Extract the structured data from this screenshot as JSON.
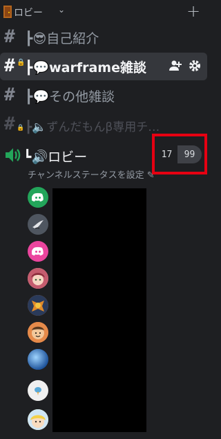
{
  "category": {
    "label": "ロビー",
    "emoji_icon": "door-icon",
    "add_icon": "plus-icon"
  },
  "channels": [
    {
      "name": "┣😎自己紹介",
      "state": "normal"
    },
    {
      "name": "┣💬warframe雑談",
      "state": "selected",
      "actions": [
        "add-member-icon",
        "gear-icon"
      ]
    },
    {
      "name": "┣💬その他雑談",
      "state": "normal"
    },
    {
      "name": "┣🔈ずんだもんβ専用チ…",
      "state": "muted"
    }
  ],
  "voice_channel": {
    "name": "┗🔊ロビー",
    "user_count": "17",
    "user_limit": "99",
    "status_text": "チャンネルステータスを設定 ✎"
  },
  "members": [
    {
      "avatar_icon": "discord-green-avatar",
      "color": "#23a55a"
    },
    {
      "avatar_icon": "bird-avatar",
      "color": "#4f5660"
    },
    {
      "avatar_icon": "discord-pink-avatar",
      "color": "#eb459e"
    },
    {
      "avatar_icon": "anime-girl-avatar",
      "color": "#e8b4b8"
    },
    {
      "avatar_icon": "character-avatar",
      "color": "#d97b2b"
    },
    {
      "avatar_icon": "cartoon-face-avatar",
      "color": "#c06a3b"
    },
    {
      "avatar_icon": "blue-sky-avatar",
      "color": "#1f6fd6"
    },
    {
      "avatar_icon": "fish-avatar",
      "color": "#f0f0f0"
    },
    {
      "avatar_icon": "yellow-hair-avatar",
      "color": "#f5d14a"
    }
  ]
}
